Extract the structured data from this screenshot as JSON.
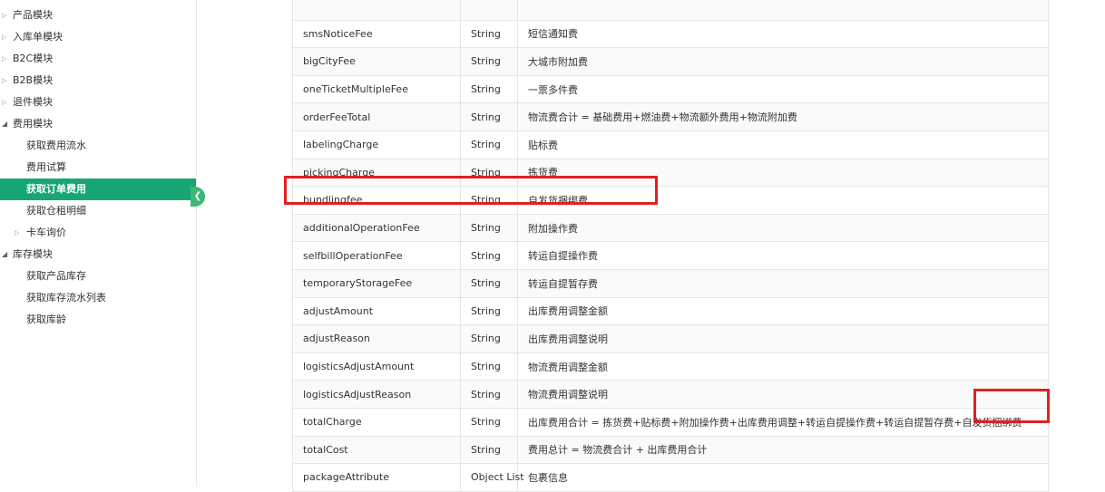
{
  "sidebar": {
    "items": [
      {
        "label": "产品模块",
        "level": 0,
        "arrow": "collapsed"
      },
      {
        "label": "入库单模块",
        "level": 0,
        "arrow": "collapsed"
      },
      {
        "label": "B2C模块",
        "level": 0,
        "arrow": "collapsed"
      },
      {
        "label": "B2B模块",
        "level": 0,
        "arrow": "collapsed"
      },
      {
        "label": "退件模块",
        "level": 0,
        "arrow": "collapsed"
      },
      {
        "label": "费用模块",
        "level": 0,
        "arrow": "expanded"
      },
      {
        "label": "获取费用流水",
        "level": 1
      },
      {
        "label": "费用试算",
        "level": 1
      },
      {
        "label": "获取订单费用",
        "level": 1,
        "active": true
      },
      {
        "label": "获取仓租明细",
        "level": 1
      },
      {
        "label": "卡车询价",
        "level": 1,
        "arrow": "collapsed"
      },
      {
        "label": "库存模块",
        "level": 0,
        "arrow": "expanded"
      },
      {
        "label": "获取产品库存",
        "level": 1
      },
      {
        "label": "获取库存流水列表",
        "level": 1
      },
      {
        "label": "获取库龄",
        "level": 1
      }
    ],
    "collapse_icon": "chevron-left-icon",
    "accent_color": "#17a673"
  },
  "table": {
    "rows": [
      {
        "name": "",
        "type": "",
        "desc": ""
      },
      {
        "name": "smsNoticeFee",
        "type": "String",
        "desc": "短信通知费"
      },
      {
        "name": "bigCityFee",
        "type": "String",
        "desc": "大城市附加费"
      },
      {
        "name": "oneTicketMultipleFee",
        "type": "String",
        "desc": "一票多件费"
      },
      {
        "name": "orderFeeTotal",
        "type": "String",
        "desc": "物流费合计 = 基础费用+燃油费+物流额外费用+物流附加费"
      },
      {
        "name": "labelingCharge",
        "type": "String",
        "desc": "贴标费"
      },
      {
        "name": "pickingCharge",
        "type": "String",
        "desc": "拣货费"
      },
      {
        "name": "bundlingfee",
        "type": "String",
        "desc": "自发货捆绑费"
      },
      {
        "name": "additionalOperationFee",
        "type": "String",
        "desc": "附加操作费"
      },
      {
        "name": "selfbillOperationFee",
        "type": "String",
        "desc": "转运自提操作费"
      },
      {
        "name": "temporaryStorageFee",
        "type": "String",
        "desc": "转运自提暂存费"
      },
      {
        "name": "adjustAmount",
        "type": "String",
        "desc": "出库费用调整金额"
      },
      {
        "name": "adjustReason",
        "type": "String",
        "desc": "出库费用调整说明"
      },
      {
        "name": "logisticsAdjustAmount",
        "type": "String",
        "desc": "物流费用调整金额"
      },
      {
        "name": "logisticsAdjustReason",
        "type": "String",
        "desc": "物流费用调整说明"
      },
      {
        "name": "totalCharge",
        "type": "String",
        "desc": "出库费用合计 = 拣货费+贴标费+附加操作费+出库费用调整+转运自提操作费+转运自提暂存费+自发货捆绑费"
      },
      {
        "name": "totalCost",
        "type": "String",
        "desc": "费用总计 = 物流费合计 + 出库费用合计"
      },
      {
        "name": "packageAttribute",
        "type": "Object List",
        "desc": "包裹信息"
      }
    ],
    "highlight_color": "#e02020"
  }
}
